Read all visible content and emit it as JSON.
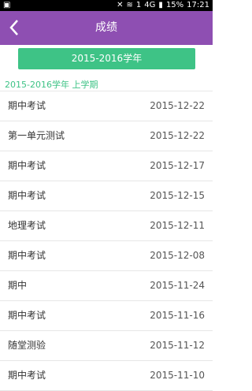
{
  "status": {
    "battery": "15%",
    "time": "17:21",
    "network": "4G"
  },
  "header": {
    "title": "成绩"
  },
  "year_button": "2015-2016学年",
  "section_title": "2015-2016学年 上学期",
  "items": [
    {
      "name": "期中考试",
      "date": "2015-12-22"
    },
    {
      "name": "第一单元测试",
      "date": "2015-12-22"
    },
    {
      "name": "期中考试",
      "date": "2015-12-17"
    },
    {
      "name": "期中考试",
      "date": "2015-12-15"
    },
    {
      "name": "地理考试",
      "date": "2015-12-11"
    },
    {
      "name": "期中考试",
      "date": "2015-12-08"
    },
    {
      "name": "期中",
      "date": "2015-11-24"
    },
    {
      "name": "期中考试",
      "date": "2015-11-16"
    },
    {
      "name": "随堂测验",
      "date": "2015-11-12"
    },
    {
      "name": "期中考试",
      "date": "2015-11-10"
    }
  ]
}
